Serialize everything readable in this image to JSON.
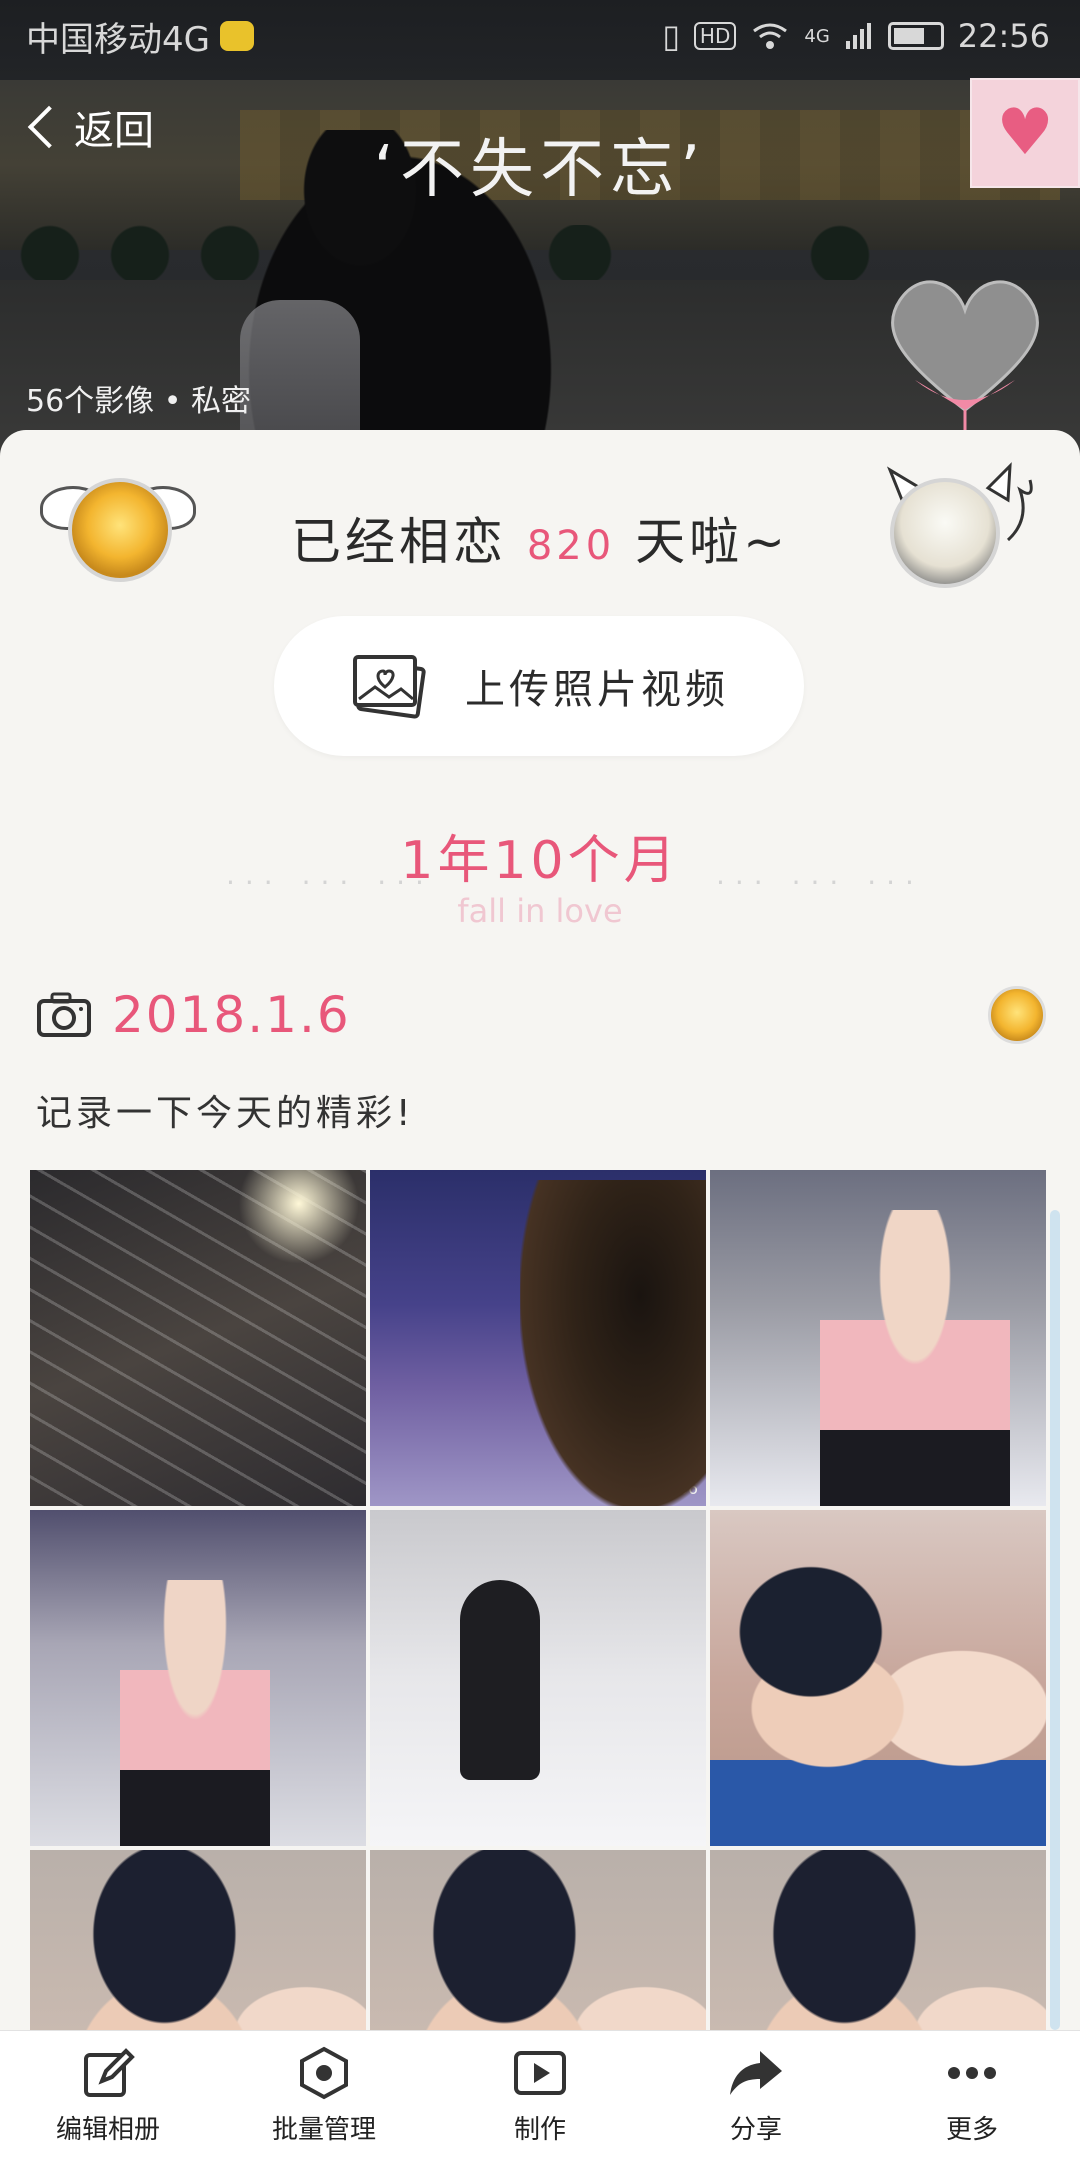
{
  "status_bar": {
    "carrier": "中国移动4G",
    "hd": "HD",
    "network": "4G",
    "time": "22:56"
  },
  "header": {
    "back_label": "返回",
    "album_title": "‘不失不忘’",
    "photo_count": "56个影像 • 私密"
  },
  "love": {
    "prefix": "已经相恋",
    "days": "820",
    "suffix": "天啦~"
  },
  "upload": {
    "label": "上传照片视频"
  },
  "duration": {
    "text": "1年10个月",
    "subtitle": "fall in love",
    "dots_left": "... ... ...",
    "dots_right": "... ... ..."
  },
  "entry": {
    "date": "2018.1.6",
    "note": "记录一下今天的精彩!",
    "photo_stamp": "2018-01-06"
  },
  "toolbar": {
    "items": [
      {
        "label": "编辑相册",
        "icon": "edit-icon"
      },
      {
        "label": "批量管理",
        "icon": "batch-icon"
      },
      {
        "label": "制作",
        "icon": "play-icon"
      },
      {
        "label": "分享",
        "icon": "share-icon"
      },
      {
        "label": "更多",
        "icon": "more-icon"
      }
    ]
  },
  "colors": {
    "accent": "#e8577a",
    "background": "#f6f5f2"
  }
}
